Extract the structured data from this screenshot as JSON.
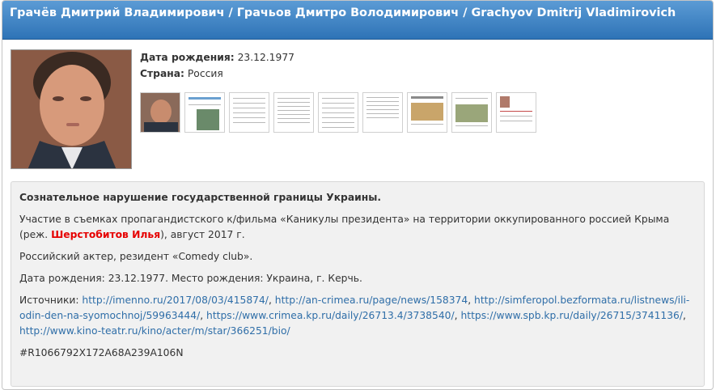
{
  "header": {
    "title": "Грачёв Дмитрий Владимирович / Грачьов Дмитро Володимирович / Grachyov Dmitrij Vladimirovich"
  },
  "meta": {
    "birth_label": "Дата рождения:",
    "birth_value": "23.12.1977",
    "country_label": "Страна:",
    "country_value": "Россия"
  },
  "description": {
    "title": "Сознательное нарушение государственной границы Украины.",
    "p1_before": "Участие в съемках пропагандистского к/фильма «Каникулы президента» на территории оккупированного россией Крыма (реж. ",
    "p1_link": "Шерстобитов Илья",
    "p1_after": "), август 2017 г.",
    "p2": "Российский актер, резидент «Comedy club».",
    "p3": "Дата рождения: 23.12.1977. Место рождения: Украина, г. Керчь.",
    "sources_label": "Источники: ",
    "sources": [
      "http://imenno.ru/2017/08/03/415874/",
      "http://an-crimea.ru/page/news/158374",
      "http://simferopol.bezformata.ru/listnews/ili-odin-den-na-syomochnoj/59963444/",
      "https://www.crimea.kp.ru/daily/26713.4/3738540/",
      "https://www.spb.kp.ru/daily/26715/3741136/",
      "http://www.kino-teatr.ru/kino/acter/m/star/366251/bio/"
    ],
    "tag": "#R1066792X172A68A239A106N"
  },
  "colors": {
    "header_top": "#5b9bd5",
    "header_bottom": "#2e73b6",
    "link": "#2f6ea8",
    "red_link": "#e60000",
    "panel_bg": "#f1f1f1"
  }
}
